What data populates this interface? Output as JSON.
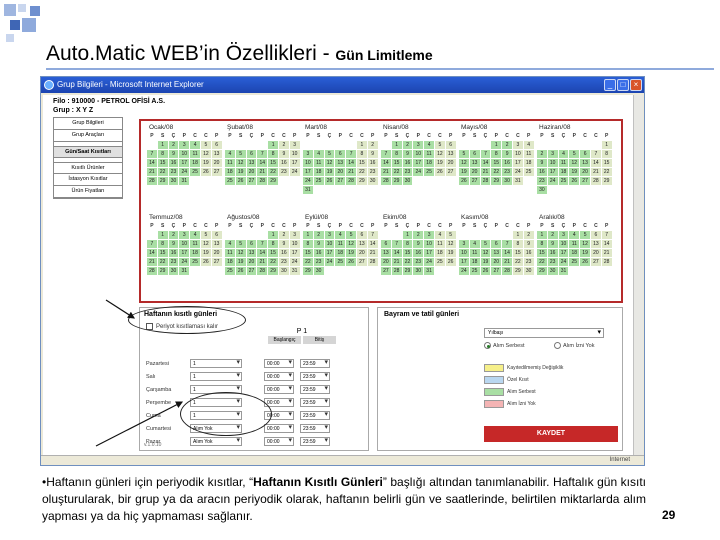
{
  "slide": {
    "title": "Auto.Matic WEB’in Özellikleri - ",
    "subtitle": "Gün Limitleme",
    "page_number": "29",
    "caption_prefix": "Haftanın günleri için periyodik kısıtlar, “",
    "caption_bold": "Haftanın Kısıtlı Günleri",
    "caption_suffix": "” başlığı altından tanımlanabilir. Haftalık gün kısıtı oluşturularak, bir grup ya da aracın periyodik olarak, haftanın belirli gün ve saatlerinde, belirtilen miktarlarda alım yapması ya da hiç yapmaması sağlanır."
  },
  "window": {
    "title": "Grup Bilgileri - Microsoft Internet Explorer",
    "firm_line": "Filo : 910000 - PETROL OFİSİ A.S.",
    "group_line": "Grup : X Y Z",
    "status_zone": "Internet"
  },
  "menu": [
    {
      "label": "Grup Bilgileri",
      "active": false
    },
    {
      "label": "Grup Araçları",
      "active": false
    },
    {
      "label": "Gün/Saat Kısıtları",
      "active": true
    },
    {
      "label": "Kısıtlı Ürünler",
      "active": false
    },
    {
      "label": "İstasyon Kısıtlar",
      "active": false
    },
    {
      "label": "Ürün Fiyatları",
      "active": false
    }
  ],
  "calendar": {
    "weekday_headers": [
      "P",
      "S",
      "Ç",
      "P",
      "C",
      "C",
      "P"
    ],
    "months": [
      {
        "name": "Ocak/08",
        "offset": 1,
        "days": 31
      },
      {
        "name": "Şubat/08",
        "offset": 4,
        "days": 29
      },
      {
        "name": "Mart/08",
        "offset": 5,
        "days": 31
      },
      {
        "name": "Nisan/08",
        "offset": 1,
        "days": 30
      },
      {
        "name": "Mayıs/08",
        "offset": 3,
        "days": 31
      },
      {
        "name": "Haziran/08",
        "offset": 6,
        "days": 30
      },
      {
        "name": "Temmuz/08",
        "offset": 1,
        "days": 31
      },
      {
        "name": "Ağustos/08",
        "offset": 4,
        "days": 31
      },
      {
        "name": "Eylül/08",
        "offset": 0,
        "days": 30
      },
      {
        "name": "Ekim/08",
        "offset": 2,
        "days": 31
      },
      {
        "name": "Kasım/08",
        "offset": 5,
        "days": 30
      },
      {
        "name": "Aralık/08",
        "offset": 0,
        "days": 31
      }
    ]
  },
  "weekly": {
    "title": "Haftanın kısıtlı günleri",
    "periodic_label": "Periyot kısıtlaması kalır",
    "period_title": "P 1",
    "col_start": "Başlangıç",
    "col_end": "Bitiş",
    "version": "v.1.0.10",
    "days": [
      {
        "name": "Pazartesi",
        "select": "1",
        "start": "00:00",
        "end": "23:59"
      },
      {
        "name": "Salı",
        "select": "1",
        "start": "00:00",
        "end": "23:59"
      },
      {
        "name": "Çarşamba",
        "select": "1",
        "start": "00:00",
        "end": "23:59"
      },
      {
        "name": "Perşembe",
        "select": "1",
        "start": "00:00",
        "end": "23:59"
      },
      {
        "name": "Cuma",
        "select": "1",
        "start": "00:00",
        "end": "23:59"
      },
      {
        "name": "Cumartesi",
        "select": "Alım Yok",
        "start": "00:00",
        "end": "23:59"
      },
      {
        "name": "Pazar",
        "select": "Alım Yok",
        "start": "00:00",
        "end": "23:59"
      }
    ]
  },
  "holiday": {
    "title": "Bayram ve tatil günleri",
    "select_value": "Yılbaşı",
    "radio_allowed": "Alım Serbest",
    "radio_none": "Alım İzni Yok",
    "legend": [
      {
        "label": "Kayıtedilmemiş Değişiklik",
        "color": "#f6f08a"
      },
      {
        "label": "Özel Kısıt",
        "color": "#b9d7f0"
      },
      {
        "label": "Alım Serbest",
        "color": "#a9dfa4"
      },
      {
        "label": "Alım İzni Yok",
        "color": "#f4b4b4"
      }
    ],
    "save_label": "KAYDET"
  }
}
